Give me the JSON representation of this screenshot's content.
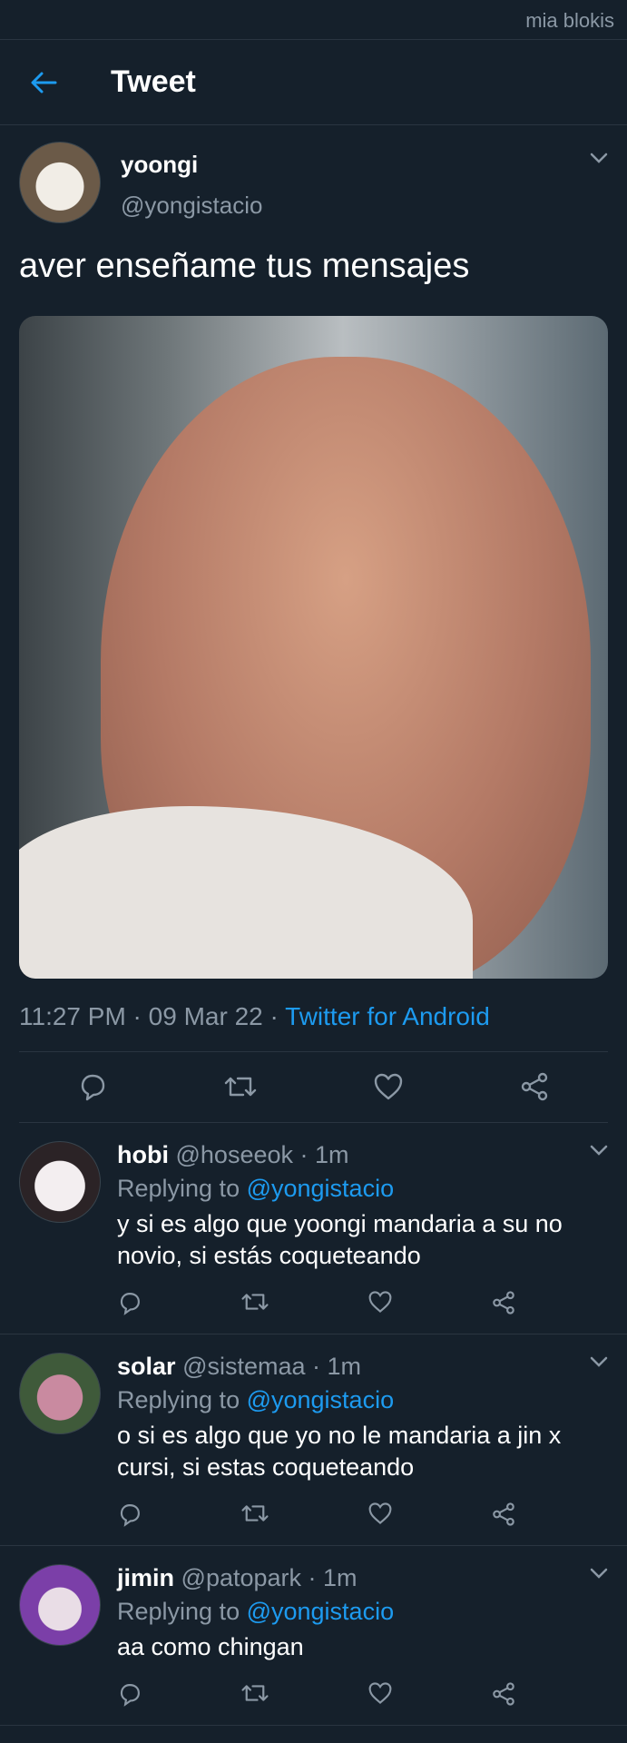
{
  "watermark": "mia blokis",
  "header": {
    "title": "Tweet"
  },
  "tweet": {
    "name": "yoongi",
    "handle": "@yongistacio",
    "text": "aver enseñame tus mensajes",
    "time": "11:27 PM",
    "sep1": " · ",
    "date": "09 Mar 22",
    "sep2": " · ",
    "client": "Twitter for Android"
  },
  "replies": [
    {
      "name": "hobi",
      "handle": "@hoseeok",
      "dot": " · ",
      "time": "1m",
      "replying_label": "Replying to ",
      "replying_to": "@yongistacio",
      "text": "y si es algo que yoongi mandaria a su no novio, si estás coqueteando"
    },
    {
      "name": "solar",
      "handle": "@sistemaa",
      "dot": " · ",
      "time": "1m",
      "replying_label": "Replying to ",
      "replying_to": "@yongistacio",
      "text": "o si es algo que yo no le mandaria a jin x cursi, si estas coqueteando"
    },
    {
      "name": "jimin",
      "handle": "@patopark",
      "dot": " · ",
      "time": "1m",
      "replying_label": "Replying to ",
      "replying_to": "@yongistacio",
      "text": "aa como chingan"
    }
  ],
  "icons": {
    "back": "arrow-left-icon",
    "more": "chevron-down-icon",
    "reply": "reply-icon",
    "retweet": "retweet-icon",
    "like": "heart-icon",
    "share": "share-icon"
  },
  "colors": {
    "background": "#15202b",
    "accent": "#1d9bf0",
    "muted": "#8b98a5",
    "divider": "#2a3541"
  }
}
